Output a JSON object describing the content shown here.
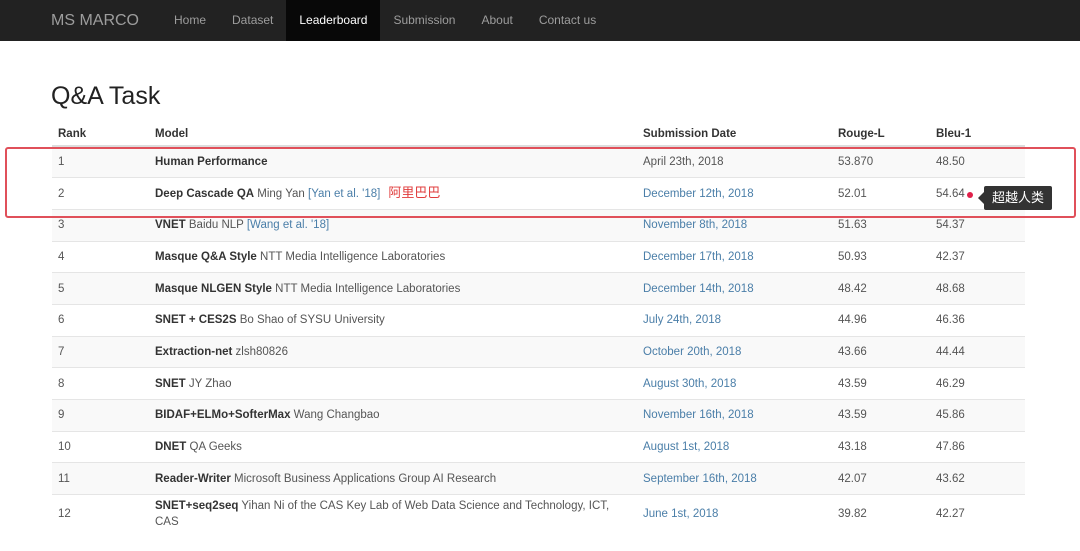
{
  "nav": {
    "brand": "MS MARCO",
    "items": [
      "Home",
      "Dataset",
      "Leaderboard",
      "Submission",
      "About",
      "Contact us"
    ],
    "active": 2
  },
  "title": "Q&A Task",
  "columns": [
    "Rank",
    "Model",
    "Submission Date",
    "Rouge-L",
    "Bleu-1"
  ],
  "rows": [
    {
      "rank": "1",
      "model": "Human Performance",
      "org": "",
      "ref": "",
      "date": "April 23th, 2018",
      "rouge": "53.870",
      "bleu": "48.50",
      "date_link": false
    },
    {
      "rank": "2",
      "model": "Deep Cascade QA",
      "org": "Ming Yan",
      "ref": "[Yan et al. '18]",
      "date": "December 12th, 2018",
      "rouge": "52.01",
      "bleu": "54.64",
      "date_link": true
    },
    {
      "rank": "3",
      "model": "VNET",
      "org": "Baidu NLP",
      "ref": "[Wang et al. '18]",
      "date": "November 8th, 2018",
      "rouge": "51.63",
      "bleu": "54.37",
      "date_link": true
    },
    {
      "rank": "4",
      "model": "Masque Q&A Style",
      "org": "NTT Media Intelligence Laboratories",
      "ref": "",
      "date": "December 17th, 2018",
      "rouge": "50.93",
      "bleu": "42.37",
      "date_link": true
    },
    {
      "rank": "5",
      "model": "Masque NLGEN Style",
      "org": "NTT Media Intelligence Laboratories",
      "ref": "",
      "date": "December 14th, 2018",
      "rouge": "48.42",
      "bleu": "48.68",
      "date_link": true
    },
    {
      "rank": "6",
      "model": "SNET + CES2S",
      "org": "Bo Shao of SYSU University",
      "ref": "",
      "date": "July 24th, 2018",
      "rouge": "44.96",
      "bleu": "46.36",
      "date_link": true
    },
    {
      "rank": "7",
      "model": "Extraction-net",
      "org": "zlsh80826",
      "ref": "",
      "date": "October 20th, 2018",
      "rouge": "43.66",
      "bleu": "44.44",
      "date_link": true
    },
    {
      "rank": "8",
      "model": "SNET",
      "org": "JY Zhao",
      "ref": "",
      "date": "August 30th, 2018",
      "rouge": "43.59",
      "bleu": "46.29",
      "date_link": true
    },
    {
      "rank": "9",
      "model": "BIDAF+ELMo+SofterMax",
      "org": "Wang Changbao",
      "ref": "",
      "date": "November 16th, 2018",
      "rouge": "43.59",
      "bleu": "45.86",
      "date_link": true
    },
    {
      "rank": "10",
      "model": "DNET",
      "org": "QA Geeks",
      "ref": "",
      "date": "August 1st, 2018",
      "rouge": "43.18",
      "bleu": "47.86",
      "date_link": true
    },
    {
      "rank": "11",
      "model": "Reader-Writer",
      "org": "Microsoft Business Applications Group AI Research",
      "ref": "",
      "date": "September 16th, 2018",
      "rouge": "42.07",
      "bleu": "43.62",
      "date_link": true
    },
    {
      "rank": "12",
      "model": "SNET+seq2seq",
      "org": "Yihan Ni of the CAS Key Lab of Web Data Science and Technology, ICT, CAS",
      "ref": "",
      "date": "June 1st, 2018",
      "rouge": "39.82",
      "bleu": "42.27",
      "date_link": true
    }
  ],
  "annotation": {
    "company": "阿里巴巴",
    "tooltip": "超越人类",
    "highlight_color": "#e0505a"
  }
}
